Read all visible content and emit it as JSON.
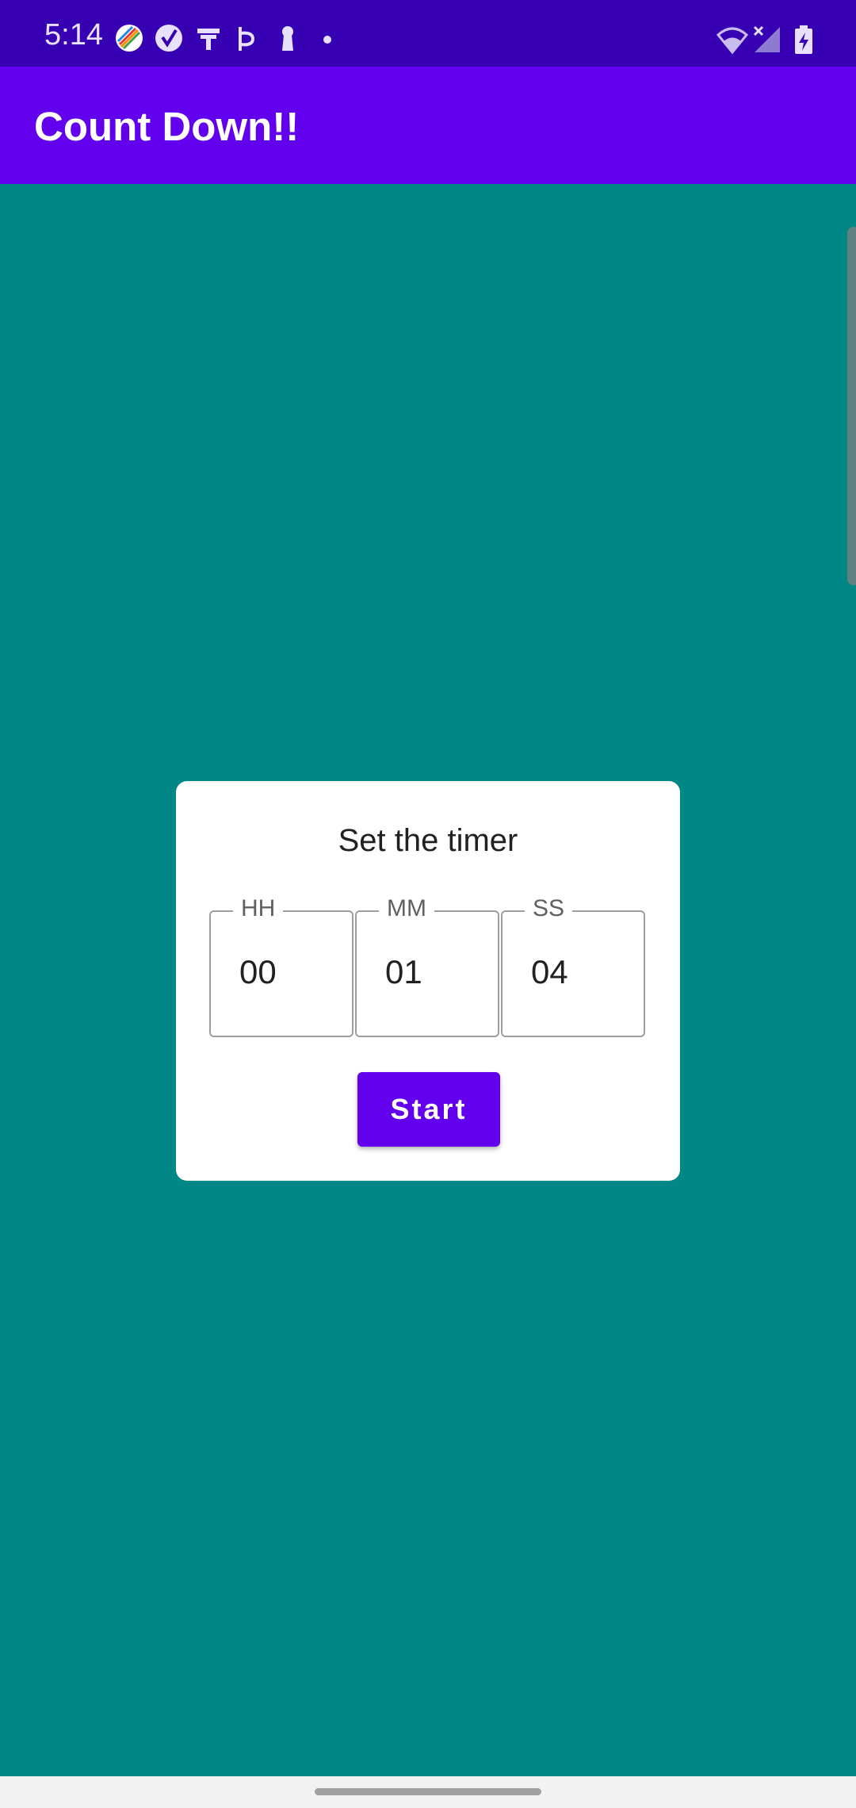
{
  "status_bar": {
    "time": "5:14",
    "notification_icons": [
      "rainbow-app-icon",
      "check-circle-icon",
      "tool-icon",
      "p-app-icon",
      "keyhole-icon",
      "more-dot-icon"
    ],
    "right_icons": [
      "wifi-icon",
      "no-signal-icon",
      "battery-charging-icon"
    ]
  },
  "app_bar": {
    "title": "Count Down!!",
    "color": "#6200EE"
  },
  "background_color": "#018786",
  "timer_dialog": {
    "title": "Set the timer",
    "fields": [
      {
        "label": "HH",
        "value": "00"
      },
      {
        "label": "MM",
        "value": "01"
      },
      {
        "label": "SS",
        "value": "04"
      }
    ],
    "start_label": "Start"
  }
}
